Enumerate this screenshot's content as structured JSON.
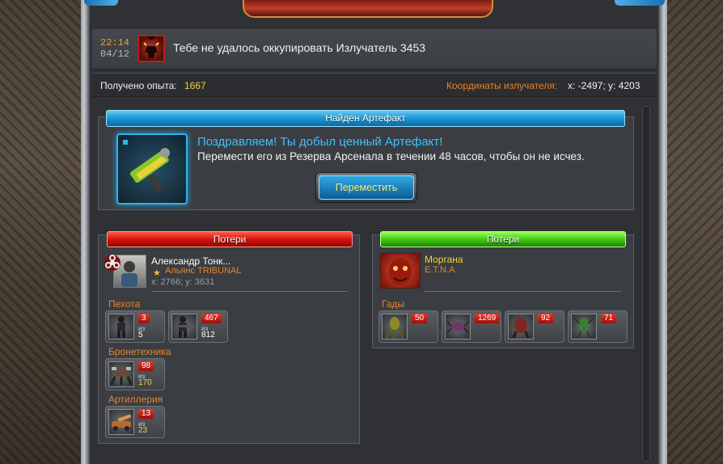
{
  "message": {
    "time": "22:14",
    "date": "04/12",
    "text": "Тебе не удалось оккупировать Излучатель 3453"
  },
  "info": {
    "xp_label": "Получено опыта:",
    "xp_value": "1667",
    "coord_label": "Координаты излучателя:",
    "coord_value": "x: -2497; y: 4203"
  },
  "artifact": {
    "header": "Найден Артефакт",
    "title": "Поздравляем! Ты добыл ценный Артефакт!",
    "subtitle": "Перемести его из Резерва Арсенала в течении 48 часов, чтобы он не исчез.",
    "button": "Переместить"
  },
  "left_panel": {
    "header": "Потери",
    "player": {
      "name": "Александр Тонк...",
      "alliance": "Альянс TRIBUNAL",
      "coords": "x: 2766; y: 3631"
    },
    "categories": [
      {
        "label": "Пехота",
        "units": [
          {
            "lost": "3",
            "of": "из",
            "total": "5",
            "icon": "soldier-icon"
          },
          {
            "lost": "467",
            "of": "из",
            "total": "812",
            "icon": "sniper-icon"
          }
        ]
      },
      {
        "label": "Бронетехника",
        "units": [
          {
            "lost": "98",
            "of": "из",
            "total": "170",
            "icon": "mech-icon"
          }
        ]
      },
      {
        "label": "Артиллерия",
        "units": [
          {
            "lost": "13",
            "of": "из",
            "total": "23",
            "icon": "artillery-icon"
          }
        ]
      }
    ]
  },
  "right_panel": {
    "header": "Потери",
    "enemy": {
      "name": "Моргана",
      "alliance": "E.T.N.A."
    },
    "categories": [
      {
        "label": "Гады",
        "units": [
          {
            "lost": "50",
            "icon": "creature-icon"
          },
          {
            "lost": "1269",
            "icon": "spider-icon"
          },
          {
            "lost": "92",
            "icon": "beast-icon"
          },
          {
            "lost": "71",
            "icon": "mantis-icon"
          }
        ]
      }
    ]
  },
  "colors": {
    "accent_orange": "#e8842a",
    "yellow": "#f6d23a",
    "blue_header": "#1d9ad8",
    "red_header": "#d6130b",
    "green_header": "#3fce12"
  }
}
